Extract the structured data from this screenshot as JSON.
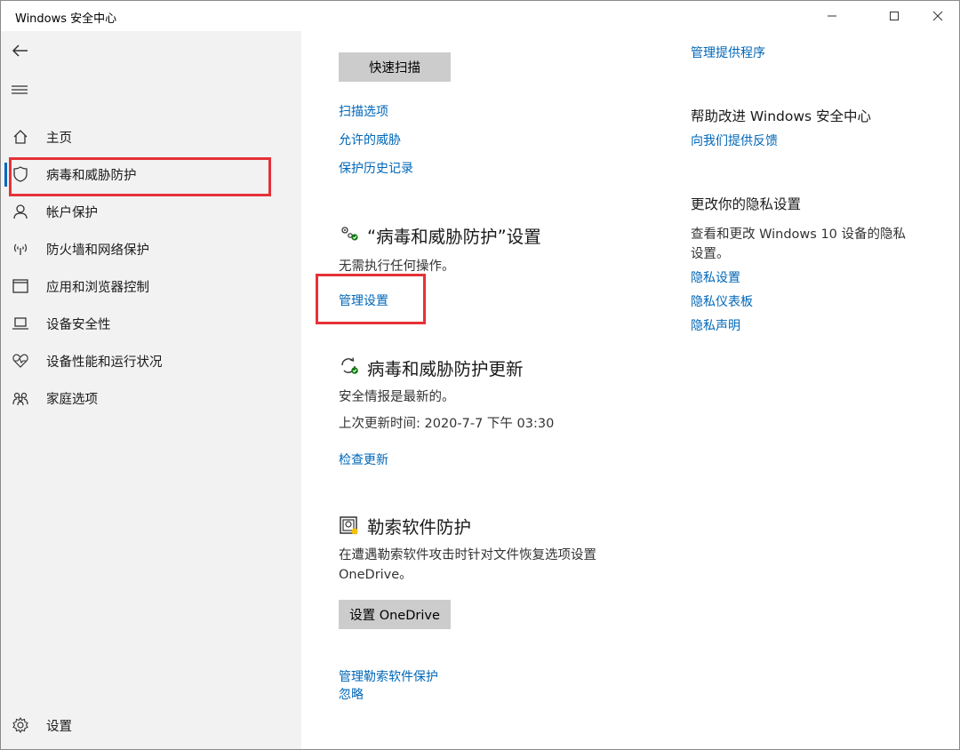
{
  "window": {
    "title": "Windows 安全中心",
    "controls": {
      "minimize": "—",
      "maximize": "☐",
      "close": "✕"
    }
  },
  "sidebar": {
    "items": [
      {
        "label": "主页",
        "icon": "home-icon"
      },
      {
        "label": "病毒和威胁防护",
        "icon": "shield-icon",
        "selected": true
      },
      {
        "label": "帐户保护",
        "icon": "person-icon"
      },
      {
        "label": "防火墙和网络保护",
        "icon": "wifi-icon"
      },
      {
        "label": "应用和浏览器控制",
        "icon": "app-window-icon"
      },
      {
        "label": "设备安全性",
        "icon": "laptop-icon"
      },
      {
        "label": "设备性能和运行状况",
        "icon": "heart-pulse-icon"
      },
      {
        "label": "家庭选项",
        "icon": "family-icon"
      }
    ],
    "settings_label": "设置"
  },
  "main": {
    "quick_scan_button": "快速扫描",
    "scan_links": [
      "扫描选项",
      "允许的威胁",
      "保护历史记录"
    ],
    "settings_section": {
      "heading": "“病毒和威胁防护”设置",
      "status": "无需执行任何操作。",
      "link": "管理设置"
    },
    "updates_section": {
      "heading": "病毒和威胁防护更新",
      "status": "安全情报是最新的。",
      "last_update": "上次更新时间: 2020-7-7 下午 03:30",
      "link": "检查更新"
    },
    "ransomware_section": {
      "heading": "勒索软件防护",
      "description_line1": "在遭遇勒索软件攻击时针对文件恢复选项设置",
      "description_line2": "OneDrive。",
      "button": "设置 OneDrive",
      "links": [
        "管理勒索软件保护",
        "忽略"
      ]
    }
  },
  "right": {
    "provider_link": "管理提供程序",
    "improve_heading": "帮助改进 Windows 安全中心",
    "feedback_link": "向我们提供反馈",
    "privacy_heading": "更改你的隐私设置",
    "privacy_desc_line1": "查看和更改 Windows 10 设备的隐私",
    "privacy_desc_line2": "设置。",
    "privacy_links": [
      "隐私设置",
      "隐私仪表板",
      "隐私声明"
    ]
  },
  "colors": {
    "accent": "#0067b8",
    "highlight": "#e53238",
    "status_ok": "#107c10"
  }
}
